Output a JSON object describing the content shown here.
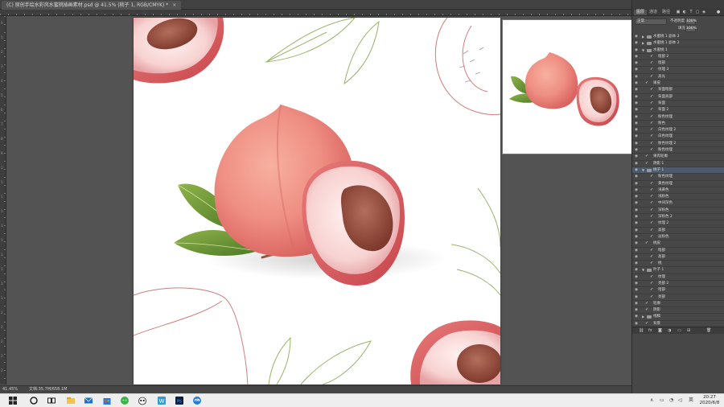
{
  "document": {
    "tab_title": "(C) 原创手绘水彩风水蜜桃插画素材.psd @ 41.5% (桃子 1, RGB/CMYK) *",
    "tab_close": "×"
  },
  "ruler": {
    "left_numbers": [
      "0",
      "1",
      "2",
      "3",
      "4",
      "5",
      "6",
      "7",
      "8",
      "9",
      "1",
      "1",
      "1",
      "1",
      "1",
      "1",
      "1",
      "1",
      "1",
      "1",
      "2",
      "2",
      "2",
      "2",
      "2"
    ]
  },
  "status": {
    "zoom": "41.45%",
    "doc_info": "文档:35.7M/658.1M"
  },
  "panel": {
    "tabs": [
      "图层",
      "通道",
      "路径"
    ],
    "blend_mode": "正常",
    "opacity_label": "不透明度:",
    "opacity_value": "100%",
    "fill_label": "填充:",
    "fill_value": "100%",
    "bottom_icons": [
      "fx-icon",
      "mask-icon",
      "adjust-icon",
      "group-icon",
      "new-layer-icon",
      "trash-icon"
    ],
    "layers": [
      {
        "name": "水蜜桃 1 副本 3",
        "kind": "group",
        "indent": 0,
        "expanded": false,
        "selected": false
      },
      {
        "name": "水蜜桃 1 副本 2",
        "kind": "group",
        "indent": 0,
        "expanded": false,
        "selected": false
      },
      {
        "name": "水蜜桃 1",
        "kind": "group",
        "indent": 0,
        "expanded": true,
        "selected": false
      },
      {
        "name": "暗部 2",
        "kind": "layer",
        "indent": 1,
        "selected": false
      },
      {
        "name": "暗部",
        "kind": "layer",
        "indent": 1,
        "selected": false
      },
      {
        "name": "纹理 3",
        "kind": "layer",
        "indent": 1,
        "selected": false
      },
      {
        "name": "高光",
        "kind": "layer",
        "indent": 1,
        "selected": false
      },
      {
        "name": "果皮",
        "kind": "layer",
        "indent": 0,
        "selected": false
      },
      {
        "name": "背面暗部",
        "kind": "layer",
        "indent": 1,
        "selected": false
      },
      {
        "name": "背面高部",
        "kind": "layer",
        "indent": 1,
        "selected": false
      },
      {
        "name": "背面",
        "kind": "layer",
        "indent": 1,
        "selected": false
      },
      {
        "name": "背面 2",
        "kind": "layer",
        "indent": 1,
        "selected": false
      },
      {
        "name": "粉色纹理",
        "kind": "layer",
        "indent": 1,
        "selected": false
      },
      {
        "name": "粉色",
        "kind": "layer",
        "indent": 1,
        "selected": false
      },
      {
        "name": "白色纹理 2",
        "kind": "layer",
        "indent": 1,
        "selected": false
      },
      {
        "name": "白色纹理",
        "kind": "layer",
        "indent": 1,
        "selected": false
      },
      {
        "name": "粉色纹理 2",
        "kind": "layer",
        "indent": 1,
        "selected": false
      },
      {
        "name": "粉色纹理",
        "kind": "layer",
        "indent": 1,
        "selected": false
      },
      {
        "name": "果肉轮廓",
        "kind": "layer",
        "indent": 0,
        "selected": false
      },
      {
        "name": "阴影 1",
        "kind": "layer",
        "indent": 0,
        "selected": false
      },
      {
        "name": "桃子 1",
        "kind": "group",
        "indent": 0,
        "expanded": true,
        "selected": true
      },
      {
        "name": "粉色纹理",
        "kind": "layer",
        "indent": 1,
        "selected": false
      },
      {
        "name": "黄色纹理",
        "kind": "layer",
        "indent": 1,
        "selected": false
      },
      {
        "name": "浅黄色",
        "kind": "layer",
        "indent": 1,
        "selected": false
      },
      {
        "name": "浅粉色",
        "kind": "layer",
        "indent": 1,
        "selected": false
      },
      {
        "name": "中间深色",
        "kind": "layer",
        "indent": 1,
        "selected": false
      },
      {
        "name": "深粉色",
        "kind": "layer",
        "indent": 1,
        "selected": false
      },
      {
        "name": "深粉色 2",
        "kind": "layer",
        "indent": 1,
        "selected": false
      },
      {
        "name": "纹理 2",
        "kind": "layer",
        "indent": 1,
        "selected": false
      },
      {
        "name": "高部",
        "kind": "layer",
        "indent": 1,
        "selected": false
      },
      {
        "name": "淡粉色",
        "kind": "layer",
        "indent": 1,
        "selected": false
      },
      {
        "name": "桃皮",
        "kind": "layer",
        "indent": 0,
        "selected": false
      },
      {
        "name": "暗部",
        "kind": "layer",
        "indent": 1,
        "selected": false
      },
      {
        "name": "高部",
        "kind": "layer",
        "indent": 1,
        "selected": false
      },
      {
        "name": "桃",
        "kind": "layer",
        "indent": 1,
        "selected": false
      },
      {
        "name": "叶子 1",
        "kind": "group",
        "indent": 0,
        "expanded": true,
        "selected": false
      },
      {
        "name": "纹理",
        "kind": "layer",
        "indent": 1,
        "selected": false
      },
      {
        "name": "亮部 2",
        "kind": "layer",
        "indent": 1,
        "selected": false
      },
      {
        "name": "暗部",
        "kind": "layer",
        "indent": 1,
        "selected": false
      },
      {
        "name": "亮部",
        "kind": "layer",
        "indent": 1,
        "selected": false
      },
      {
        "name": "轮廓",
        "kind": "layer",
        "indent": 0,
        "selected": false
      },
      {
        "name": "阴影",
        "kind": "layer",
        "indent": 0,
        "selected": false
      },
      {
        "name": "线稿",
        "kind": "group",
        "indent": 0,
        "expanded": false,
        "selected": false
      },
      {
        "name": "背景",
        "kind": "layer",
        "indent": 0,
        "selected": false
      }
    ]
  },
  "taskbar": {
    "apps": [
      "file-explorer-icon",
      "mail-icon",
      "store-icon",
      "wechat-icon",
      "panda-icon",
      "word-icon",
      "photoshop-icon",
      "edge-icon"
    ],
    "ime": "英",
    "time": "20:27",
    "date": "2020/6/8"
  }
}
